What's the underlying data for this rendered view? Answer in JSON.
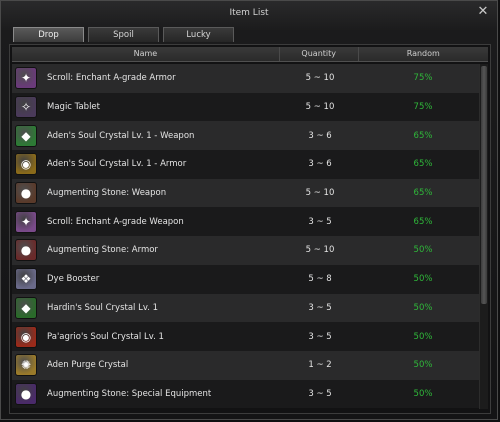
{
  "window": {
    "title": "Item List",
    "close_glyph": "✕"
  },
  "tabs": [
    {
      "label": "Drop",
      "active": true
    },
    {
      "label": "Spoil",
      "active": false
    },
    {
      "label": "Lucky",
      "active": false
    }
  ],
  "table": {
    "headers": {
      "name": "Name",
      "quantity": "Quantity",
      "random": "Random"
    },
    "rows": [
      {
        "icon": "enchant-scroll-icon",
        "icon_color": "#6a3a7a",
        "glyph": "✦",
        "name": "Scroll: Enchant A-grade Armor",
        "quantity": "5 ~ 10",
        "random": "75%"
      },
      {
        "icon": "magic-tablet-icon",
        "icon_color": "#4a3a5a",
        "glyph": "✧",
        "name": "Magic Tablet",
        "quantity": "5 ~ 10",
        "random": "75%"
      },
      {
        "icon": "soul-crystal-green-icon",
        "icon_color": "#2d7a35",
        "glyph": "◆",
        "name": "Aden's Soul Crystal Lv. 1 - Weapon",
        "quantity": "3 ~ 6",
        "random": "65%"
      },
      {
        "icon": "soul-crystal-gold-icon",
        "icon_color": "#8a6a1a",
        "glyph": "◉",
        "name": "Aden's Soul Crystal Lv. 1 - Armor",
        "quantity": "3 ~ 6",
        "random": "65%"
      },
      {
        "icon": "augmenting-stone-icon",
        "icon_color": "#5a3a2a",
        "glyph": "●",
        "name": "Augmenting Stone: Weapon",
        "quantity": "5 ~ 10",
        "random": "65%"
      },
      {
        "icon": "enchant-scroll-icon",
        "icon_color": "#7a4a8a",
        "glyph": "✦",
        "name": "Scroll: Enchant A-grade Weapon",
        "quantity": "3 ~ 5",
        "random": "65%"
      },
      {
        "icon": "augmenting-stone-icon",
        "icon_color": "#6a2a2a",
        "glyph": "●",
        "name": "Augmenting Stone: Armor",
        "quantity": "5 ~ 10",
        "random": "50%"
      },
      {
        "icon": "dye-booster-icon",
        "icon_color": "#6a6a8a",
        "glyph": "❖",
        "name": "Dye Booster",
        "quantity": "5 ~ 8",
        "random": "50%"
      },
      {
        "icon": "soul-crystal-green-icon",
        "icon_color": "#2a6a2a",
        "glyph": "◆",
        "name": "Hardin's Soul Crystal Lv. 1",
        "quantity": "3 ~ 5",
        "random": "50%"
      },
      {
        "icon": "soul-crystal-red-icon",
        "icon_color": "#9a2a1a",
        "glyph": "◉",
        "name": "Pa'agrio's Soul Crystal Lv. 1",
        "quantity": "3 ~ 5",
        "random": "50%"
      },
      {
        "icon": "purge-crystal-icon",
        "icon_color": "#9a7a2a",
        "glyph": "✺",
        "name": "Aden Purge Crystal",
        "quantity": "1 ~ 2",
        "random": "50%"
      },
      {
        "icon": "augmenting-stone-purple-icon",
        "icon_color": "#4a2a6a",
        "glyph": "●",
        "name": "Augmenting Stone: Special Equipment",
        "quantity": "3 ~ 5",
        "random": "50%"
      }
    ]
  }
}
